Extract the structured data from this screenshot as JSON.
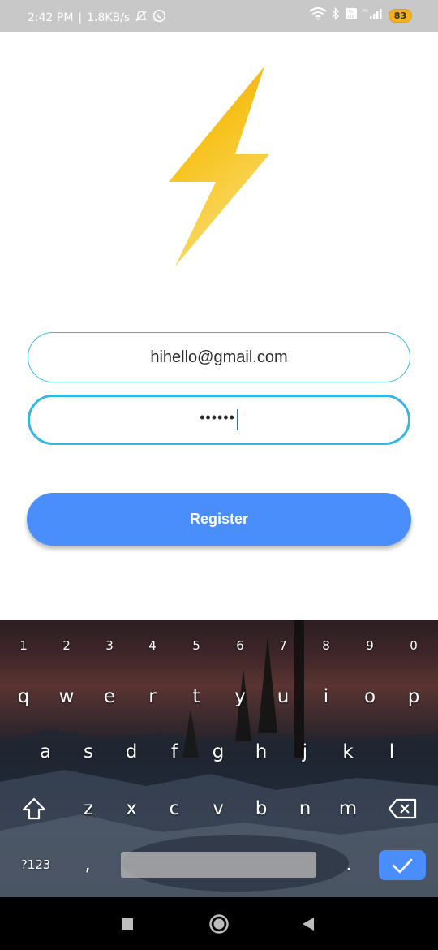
{
  "status_bar": {
    "time": "2:42 PM",
    "separator": "|",
    "net_speed": "1.8KB/s",
    "battery": "83",
    "icons": [
      "mute-bell-icon",
      "whatsapp-icon",
      "wifi-icon",
      "bluetooth-icon",
      "volte-icon",
      "signal-icon",
      "battery-icon"
    ]
  },
  "logo": {
    "icon": "lightning-bolt-icon",
    "colors": [
      "#f7c21c",
      "#f0a21e",
      "#f8d45c"
    ]
  },
  "form": {
    "email_value": "hihello@gmail.com",
    "password_value": "••••••",
    "border_color": "#33b7e6"
  },
  "register": {
    "label": "Register",
    "color": "#4a8efc"
  },
  "keyboard": {
    "number_row": [
      "1",
      "2",
      "3",
      "4",
      "5",
      "6",
      "7",
      "8",
      "9",
      "0"
    ],
    "row1": [
      "q",
      "w",
      "e",
      "r",
      "t",
      "y",
      "u",
      "i",
      "o",
      "p"
    ],
    "row2": [
      "a",
      "s",
      "d",
      "f",
      "g",
      "h",
      "j",
      "k",
      "l"
    ],
    "row3": [
      "z",
      "x",
      "c",
      "v",
      "b",
      "n",
      "m"
    ],
    "symbols_label": "?123",
    "comma": ",",
    "period": "."
  },
  "nav": {
    "icons": [
      "recent-apps-icon",
      "home-icon",
      "back-icon"
    ]
  }
}
